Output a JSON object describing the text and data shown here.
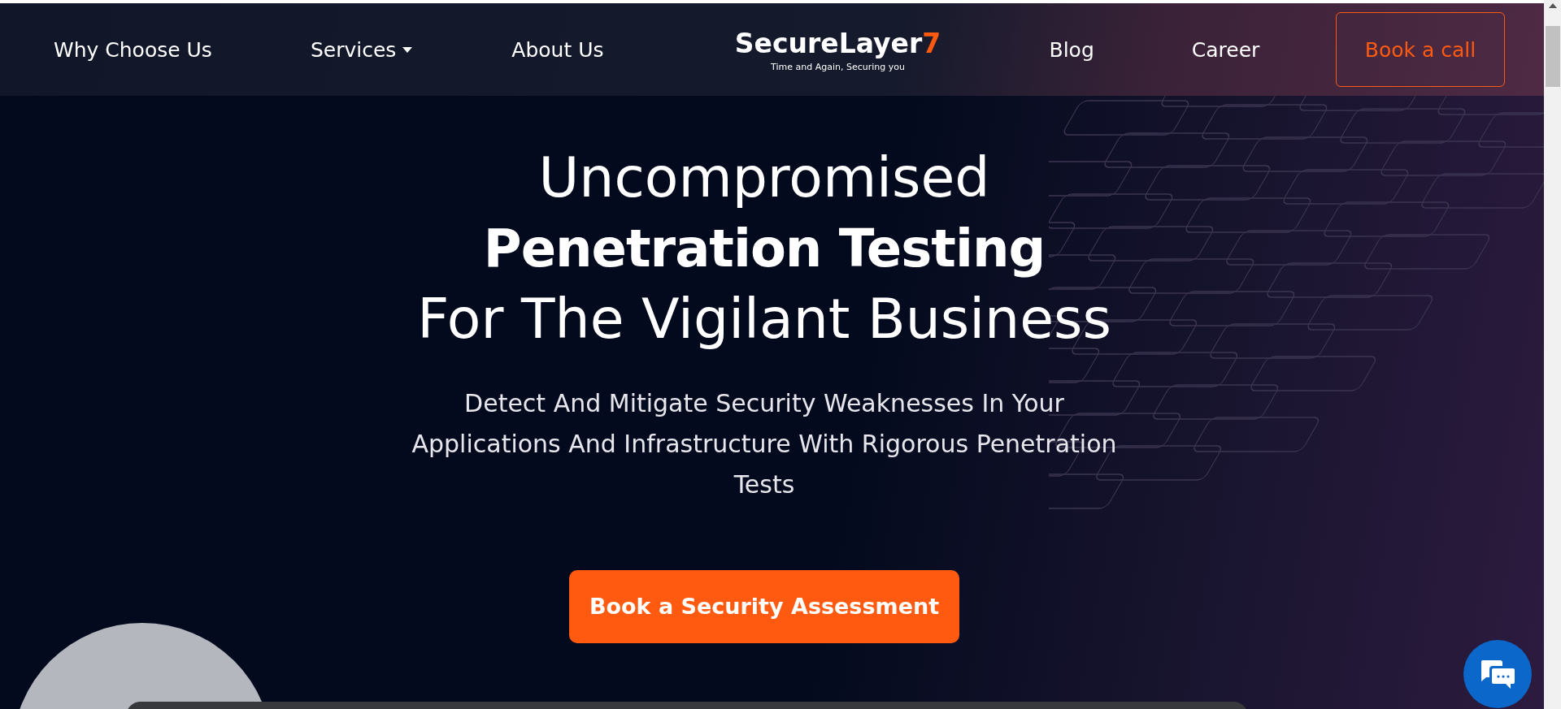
{
  "nav": {
    "items": [
      {
        "label": "Why Choose Us",
        "dropdown": false
      },
      {
        "label": "Services",
        "dropdown": true
      },
      {
        "label": "About Us",
        "dropdown": false
      }
    ],
    "logo": {
      "name": "SecureLayer",
      "mark": "7",
      "tagline": "Time and Again, Securing you"
    },
    "items_right": [
      {
        "label": "Blog"
      },
      {
        "label": "Career"
      }
    ],
    "cta": "Book a call"
  },
  "hero": {
    "line1": "Uncompromised",
    "line2": "Penetration Testing",
    "line3": "For The Vigilant Business",
    "subtitle": "Detect And Mitigate Security Weaknesses In Your Applications And Infrastructure With Rigorous Penetration Tests",
    "button": "Book a Security Assessment"
  }
}
